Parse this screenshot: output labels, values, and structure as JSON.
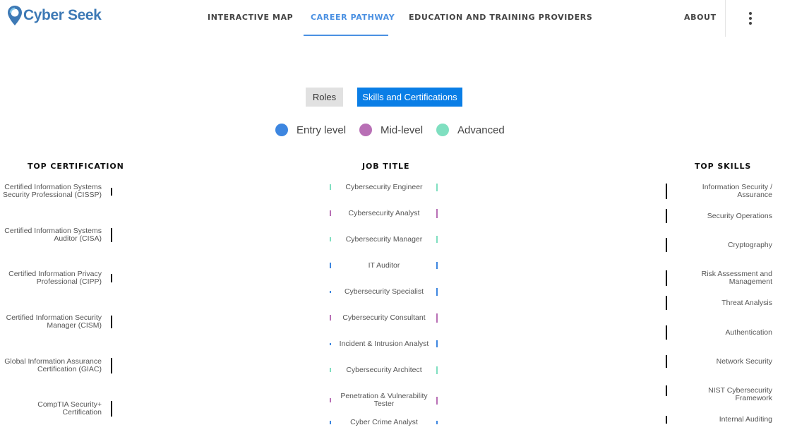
{
  "app": {
    "name": "Cyber Seek"
  },
  "nav": {
    "items": [
      {
        "label": "INTERACTIVE MAP",
        "active": false
      },
      {
        "label": "CAREER PATHWAY",
        "active": true
      },
      {
        "label": "EDUCATION AND TRAINING PROVIDERS",
        "active": false
      },
      {
        "label": "ABOUT",
        "active": false
      }
    ],
    "more_icon": "more-vertical-icon"
  },
  "view_toggle": {
    "roles_label": "Roles",
    "skills_label": "Skills and Certifications",
    "selected": "Skills and Certifications"
  },
  "legend": [
    {
      "label": "Entry level",
      "color": "#3d86e0"
    },
    {
      "label": "Mid-level",
      "color": "#b86fb5"
    },
    {
      "label": "Advanced",
      "color": "#7fdfc0"
    }
  ],
  "columns": {
    "certifications_heading": "TOP CERTIFICATION",
    "jobs_heading": "JOB TITLE",
    "skills_heading": "TOP SKILLS"
  },
  "certifications": [
    {
      "label": "Certified Information Systems Security Professional (CISSP)",
      "weight": 0.5
    },
    {
      "label": "Certified Information Systems Auditor (CISA)",
      "weight": 0.9
    },
    {
      "label": "Certified Information Privacy Professional (CIPP)",
      "weight": 0.55
    },
    {
      "label": "Certified Information Security Manager (CISM)",
      "weight": 0.8
    },
    {
      "label": "Global Information Assurance Certification (GIAC)",
      "weight": 1.0
    },
    {
      "label": "CompTIA Security+ Certification",
      "weight": 1.0
    }
  ],
  "jobs": [
    {
      "label": "Cybersecurity Engineer",
      "level": "Advanced",
      "color": "#7fdfc0",
      "left_weight": 0.5,
      "right_weight": 0.7
    },
    {
      "label": "Cybersecurity Analyst",
      "level": "Mid-level",
      "color": "#b86fb5",
      "left_weight": 0.5,
      "right_weight": 0.8
    },
    {
      "label": "Cybersecurity Manager",
      "level": "Advanced",
      "color": "#7fdfc0",
      "left_weight": 0.4,
      "right_weight": 0.6
    },
    {
      "label": "IT Auditor",
      "level": "Entry level",
      "color": "#3d86e0",
      "left_weight": 0.5,
      "right_weight": 0.6
    },
    {
      "label": "Cybersecurity Specialist",
      "level": "Entry level",
      "color": "#3d86e0",
      "left_weight": 0.2,
      "right_weight": 0.7
    },
    {
      "label": "Cybersecurity Consultant",
      "level": "Mid-level",
      "color": "#b86fb5",
      "left_weight": 0.5,
      "right_weight": 0.8
    },
    {
      "label": "Incident & Intrusion Analyst",
      "level": "Entry level",
      "color": "#3d86e0",
      "left_weight": 0.2,
      "right_weight": 0.6
    },
    {
      "label": "Cybersecurity Architect",
      "level": "Advanced",
      "color": "#7fdfc0",
      "left_weight": 0.4,
      "right_weight": 0.7
    },
    {
      "label": "Penetration & Vulnerability Tester",
      "level": "Mid-level",
      "color": "#b86fb5",
      "left_weight": 0.4,
      "right_weight": 0.7
    },
    {
      "label": "Cyber Crime Analyst",
      "level": "Entry level",
      "color": "#3d86e0",
      "left_weight": 0.3,
      "right_weight": 0.3
    }
  ],
  "skills": [
    {
      "label": "Information Security / Assurance",
      "weight": 1.0
    },
    {
      "label": "Security Operations",
      "weight": 0.9
    },
    {
      "label": "Cryptography",
      "weight": 0.9
    },
    {
      "label": "Risk Assessment and Management",
      "weight": 1.0
    },
    {
      "label": "Threat Analysis",
      "weight": 0.9
    },
    {
      "label": "Authentication",
      "weight": 0.9
    },
    {
      "label": "Network Security",
      "weight": 0.8
    },
    {
      "label": "NIST Cybersecurity Framework",
      "weight": 0.7
    },
    {
      "label": "Internal Auditing",
      "weight": 0.5
    }
  ]
}
